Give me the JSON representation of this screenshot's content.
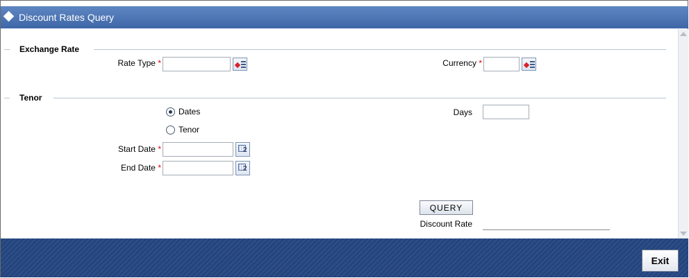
{
  "window": {
    "title": "Discount Rates Query"
  },
  "exchange_rate": {
    "section_title": "Exchange Rate",
    "rate_type_label": "Rate Type",
    "rate_type_value": "",
    "currency_label": "Currency",
    "currency_value": "",
    "required_mark": "*"
  },
  "tenor": {
    "section_title": "Tenor",
    "options": [
      {
        "label": "Dates",
        "checked": true
      },
      {
        "label": "Tenor",
        "checked": false
      }
    ],
    "days_label": "Days",
    "days_value": "",
    "start_date_label": "Start Date",
    "start_date_value": "",
    "end_date_label": "End Date",
    "end_date_value": "",
    "required_mark": "*"
  },
  "actions": {
    "query_label": "QUERY",
    "discount_rate_label": "Discount Rate",
    "discount_rate_value": ""
  },
  "footer": {
    "exit_label": "Exit"
  },
  "colors": {
    "title_bar": "#4a72b3",
    "footer": "#2a4a84",
    "required": "#e00000"
  }
}
